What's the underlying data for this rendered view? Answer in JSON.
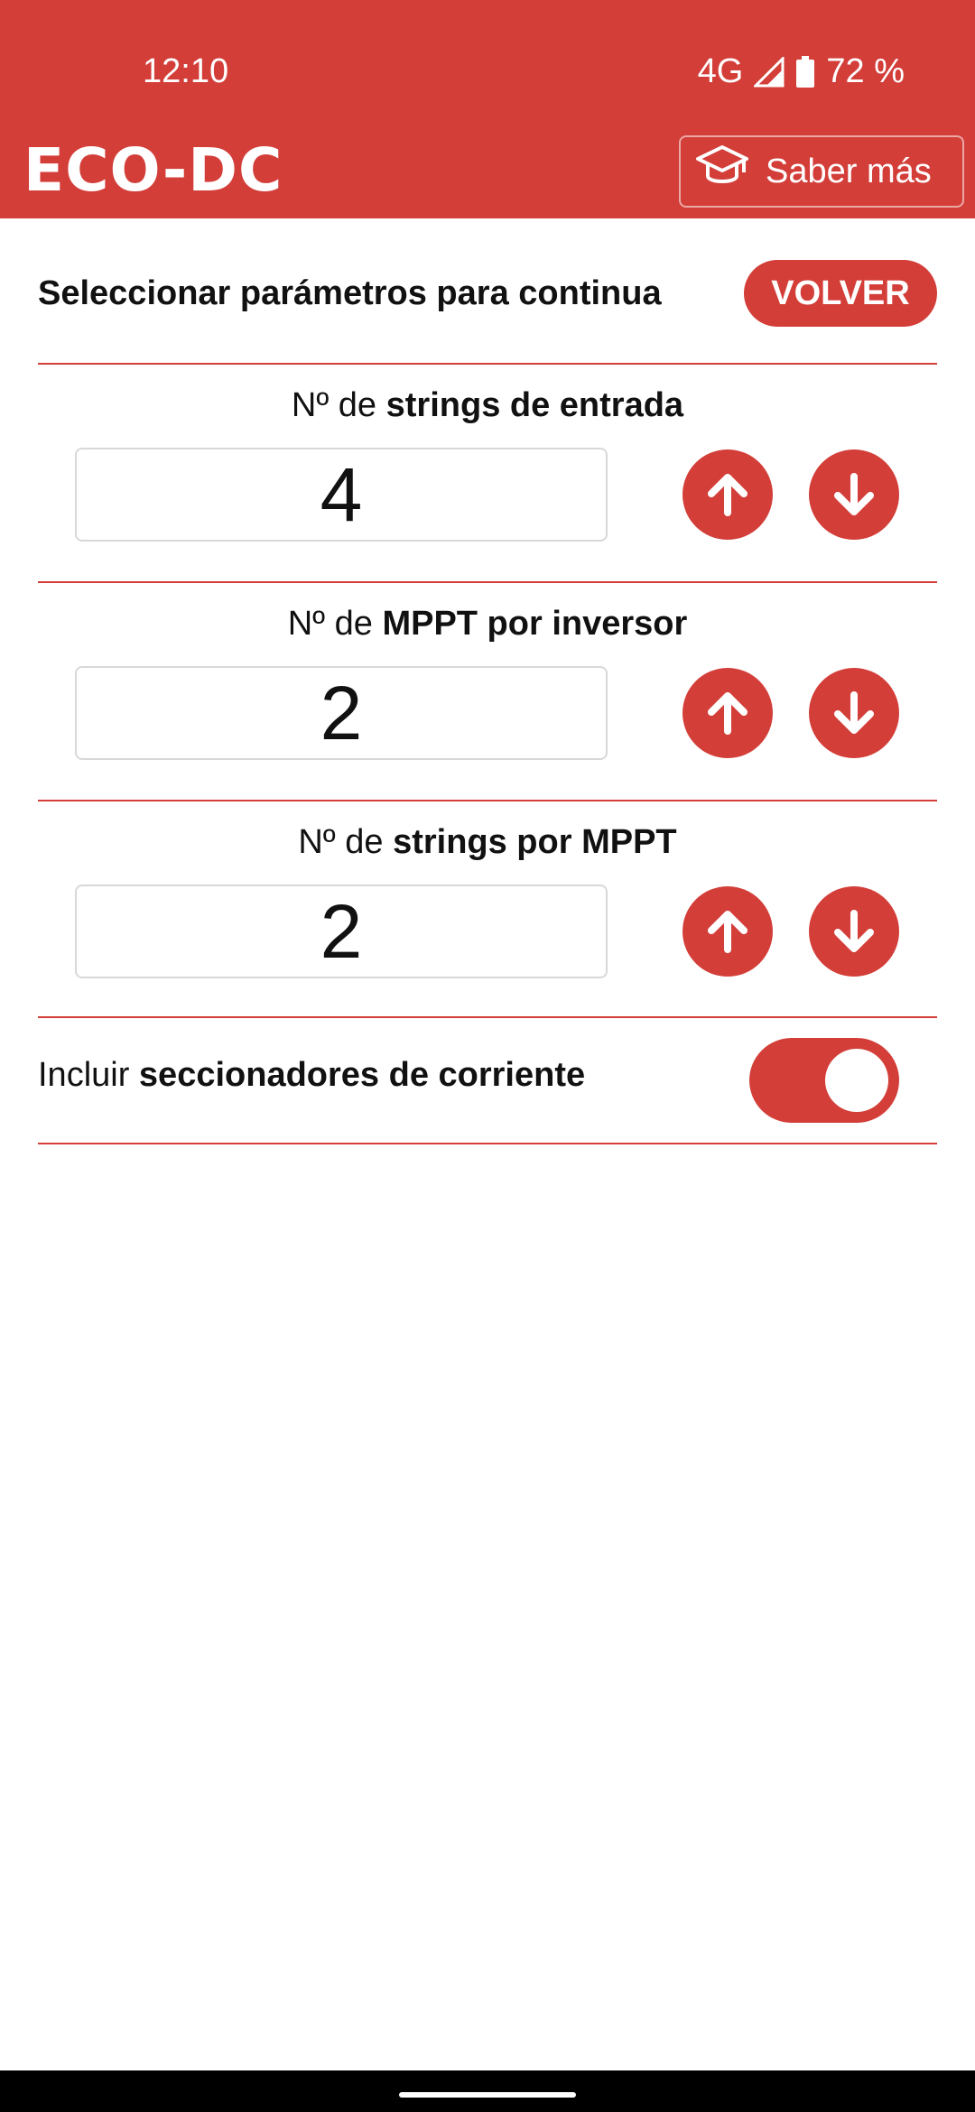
{
  "status_bar": {
    "time": "12:10",
    "network": "4G",
    "battery": "72 %"
  },
  "app_bar": {
    "title": "ECO-DC",
    "learn_more_label": "Saber más",
    "learn_more_icon": "graduation-cap-icon"
  },
  "header_row": {
    "title": "Seleccionar parámetros para continua",
    "back_label": "VOLVER"
  },
  "params": [
    {
      "prefix": "Nº de ",
      "bold": "strings de entrada",
      "value": "4"
    },
    {
      "prefix": "Nº de ",
      "bold": "MPPT por inversor",
      "value": "2"
    },
    {
      "prefix": "Nº de ",
      "bold": "strings por MPPT",
      "value": "2"
    }
  ],
  "toggle": {
    "prefix": "Incluir ",
    "bold": "seccionadores de corriente",
    "checked": true
  },
  "colors": {
    "accent": "#d33e39",
    "background": "#ffffff"
  }
}
